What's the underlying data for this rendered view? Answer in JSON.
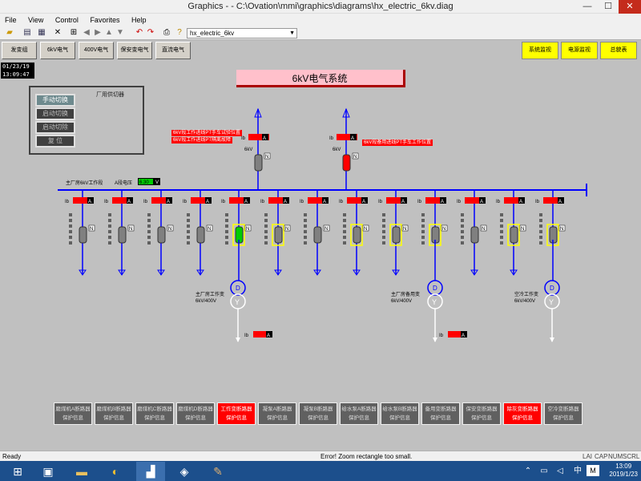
{
  "window": {
    "title": "Graphics -  - C:\\Ovation\\mmi\\graphics\\diagrams\\hx_electric_6kv.diag",
    "controls": [
      "—",
      "☐",
      "✕"
    ]
  },
  "menu": [
    "File",
    "View",
    "Control",
    "Favorites",
    "Help"
  ],
  "toolbar": {
    "diagram_select": "hx_electric_6kv"
  },
  "nav_buttons": [
    "发变组",
    "6kV电气",
    "400V电气",
    "保安变电气",
    "直流电气"
  ],
  "right_buttons": [
    "系统监视",
    "电源监视",
    "总貌表"
  ],
  "datetime": {
    "date": "01/23/19",
    "time": "13:09:47"
  },
  "banner": "6kV电气系统",
  "control_panel": {
    "label": "厂用供切器",
    "buttons": [
      "手动切换",
      "启动切换",
      "启动切除",
      "复 位"
    ]
  },
  "bus": {
    "left_label": "主厂房6kV工作段",
    "volt_label": "A段电压",
    "volt_value": "6.30",
    "volt_unit": "V"
  },
  "incomers": [
    {
      "ib": "Ib",
      "unit": "A",
      "label": "6kV",
      "alarm": [
        "6kV段工作进线PT手车试验位置",
        "6kV段工作进线PT隔离故障"
      ]
    },
    {
      "ib": "Ib",
      "unit": "A",
      "label": "6kV",
      "alarm": [
        "6kV段备用进线PT手车工作位置"
      ]
    }
  ],
  "feeders": {
    "ib": "Ib",
    "unit": "A",
    "count": 13
  },
  "transformers": [
    {
      "name": "主厂房工作变",
      "rating": "6kV/400V"
    },
    {
      "name": "主厂房备用变",
      "rating": "6kV/400V"
    },
    {
      "name": "空冷工作变",
      "rating": "6kV/400V"
    }
  ],
  "low_ib": [
    {
      "ib": "Ib",
      "unit": "A"
    },
    {
      "ib": "Ib",
      "unit": "A"
    }
  ],
  "bottom_buttons": [
    {
      "line1": "磨煤机A断路器",
      "line2": "保护信息",
      "red": false
    },
    {
      "line1": "磨煤机B断路器",
      "line2": "保护信息",
      "red": false
    },
    {
      "line1": "磨煤机C断路器",
      "line2": "保护信息",
      "red": false
    },
    {
      "line1": "磨煤机D断路器",
      "line2": "保护信息",
      "red": false
    },
    {
      "line1": "工作变断路器",
      "line2": "保护信息",
      "red": true
    },
    {
      "line1": "凝泵A断路器",
      "line2": "保护信息",
      "red": false
    },
    {
      "line1": "凝泵B断路器",
      "line2": "保护信息",
      "red": false
    },
    {
      "line1": "给水泵A断路器",
      "line2": "保护信息",
      "red": false
    },
    {
      "line1": "给水泵B断路器",
      "line2": "保护信息",
      "red": false
    },
    {
      "line1": "备用变断路器",
      "line2": "保护信息",
      "red": false
    },
    {
      "line1": "保安变断路器",
      "line2": "保护信息",
      "red": false
    },
    {
      "line1": "除灰变断路器",
      "line2": "保护信息",
      "red": true
    },
    {
      "line1": "空冷变断路器",
      "line2": "保护信息",
      "red": false
    }
  ],
  "status": {
    "left": "Ready",
    "message": "Error!  Zoom rectangle too small.",
    "indicators": [
      "LAI",
      "CAP",
      "NUM",
      "SCRL"
    ]
  },
  "clock": {
    "time": "13:09",
    "date": "2019/1/23"
  },
  "colors": {
    "bus": "#0000ff",
    "alarm": "#ff0000",
    "breaker_closed": "#00ff00",
    "yellow": "#ffff00"
  }
}
